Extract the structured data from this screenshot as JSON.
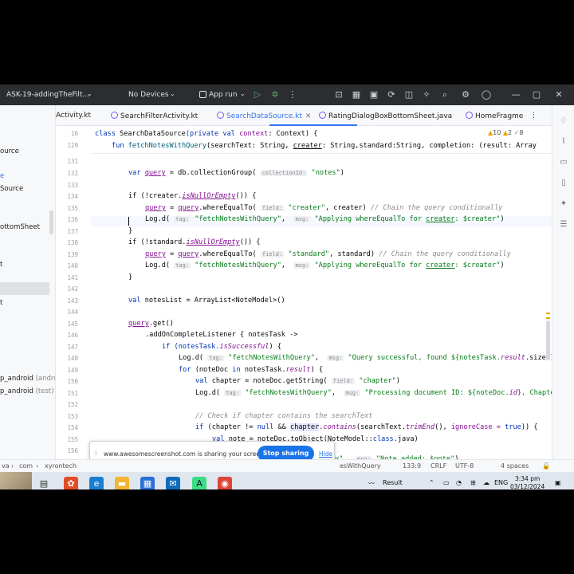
{
  "titlebar": {
    "project": "ASK-19-addingTheFilt...",
    "devices": "No Devices",
    "run_config": "App run"
  },
  "tabs": [
    {
      "label": "Activity.kt"
    },
    {
      "label": "SearchFilterActivity.kt"
    },
    {
      "label": "SearchDataSource.kt"
    },
    {
      "label": "RatingDialogBoxBottomSheet.java"
    },
    {
      "label": "HomeFragme"
    }
  ],
  "inspection": {
    "warnings": "10",
    "weak": "2",
    "ok": "8"
  },
  "project_tree": [
    "ource",
    "e",
    "Source",
    "ottomSheet",
    "t",
    "",
    "t",
    "p_android",
    "p_android"
  ],
  "project_tree_suffix": [
    "(andro",
    "(test)"
  ],
  "gutter": [
    "16",
    "129",
    "131",
    "132",
    "133",
    "134",
    "135",
    "136",
    "137",
    "138",
    "139",
    "140",
    "141",
    "142",
    "143",
    "144",
    "145",
    "146",
    "147",
    "148",
    "149",
    "150",
    "151",
    "152",
    "153",
    "154",
    "155",
    "156"
  ],
  "code": {
    "l16": [
      "class ",
      "SearchDataSource",
      "(private val ",
      "context",
      ": Context) {"
    ],
    "l129": [
      "fun ",
      "fetchNotesWithQuery",
      "(searchText: String, ",
      "creater",
      ": String,standard:String, completion: (result: Array"
    ],
    "l132_a": "var ",
    "l132_b": "query",
    "l132_c": " = db.collectionGroup( ",
    "l132_hint": "collectionId:",
    "l132_str": " \"notes\"",
    "l132_d": ")",
    "l134_a": "if (!creater.",
    "l134_b": "isNullOrEmpty",
    "l134_c": "()) {",
    "l135_a": "query",
    "l135_b": " = ",
    "l135_c": "query",
    "l135_d": ".whereEqualTo( ",
    "l135_hint": "field:",
    "l135_str": " \"creater\"",
    "l135_e": ", creater) ",
    "l135_cm": "// Chain the query conditionally",
    "l136_a": "Log.d( ",
    "l136_hint1": "tag:",
    "l136_str1": " \"fetchNotesWithQuery\"",
    "l136_b": ",  ",
    "l136_hint2": "msg:",
    "l136_str2": " \"Applying whereEqualTo for ",
    "l136_ul": "creater",
    "l136_str3": ": $creater\"",
    "l136_c": ")",
    "l137": "}",
    "l138_a": "if (!standard.",
    "l138_b": "isNullOrEmpty",
    "l138_c": "()) {",
    "l139_a": "query",
    "l139_b": " = ",
    "l139_c": "query",
    "l139_d": ".whereEqualTo( ",
    "l139_hint": "field:",
    "l139_str": " \"standard\"",
    "l139_e": ", standard) ",
    "l139_cm": "// Chain the query conditionally",
    "l140_a": "Log.d( ",
    "l140_hint1": "tag:",
    "l140_str1": " \"fetchNotesWithQuery\"",
    "l140_b": ",  ",
    "l140_hint2": "msg:",
    "l140_str2": " \"Applying whereEqualTo for ",
    "l140_ul": "creater",
    "l140_str3": ": $creater\"",
    "l140_c": ")",
    "l141": "}",
    "l143_a": "val ",
    "l143_b": "notesList = ArrayList<NoteModel>()",
    "l145_a": "query",
    "l145_b": ".get()",
    "l146_a": ".addOnCompleteListener { notesTask ->",
    "l147_a": "if (notesTask.",
    "l147_b": "isSuccessful",
    "l147_c": ") {",
    "l148_a": "Log.d( ",
    "l148_hint1": "tag:",
    "l148_str1": " \"fetchNotesWithQuery\"",
    "l148_b": ",  ",
    "l148_hint2": "msg:",
    "l148_str2": " \"Query successful, found ${notesTask.",
    "l148_it": "result",
    "l148_str3": ".size()",
    "l149_a": "for ",
    "l149_b": "(noteDoc ",
    "l149_c": "in ",
    "l149_d": "notesTask.",
    "l149_it": "result",
    "l149_e": ") {",
    "l150_a": "val ",
    "l150_b": "chapter = noteDoc.getString( ",
    "l150_hint": "field:",
    "l150_str": " \"chapter\"",
    "l150_c": ")",
    "l151_a": "Log.d( ",
    "l151_hint1": "tag:",
    "l151_str1": " \"fetchNotesWithQuery\"",
    "l151_b": ",  ",
    "l151_hint2": "msg:",
    "l151_str2": " \"Processing document ID: ${noteDoc.",
    "l151_it": "id",
    "l151_str3": "}, Chapte",
    "l153_cm": "// Check if chapter contains the searchText",
    "l154_a": "if ",
    "l154_b": "(chapter != ",
    "l154_c": "null ",
    "l154_d": "&& ",
    "l154_e": "chapter",
    "l154_f": ".",
    "l154_g": "contains",
    "l154_h": "(searchText.",
    "l154_i": "trimEnd",
    "l154_j": "(), ",
    "l154_k": "ignoreCase = ",
    "l154_l": "true",
    "l154_m": ")) {",
    "l155_a": "val ",
    "l155_b": "note = noteDoc.toObject(NoteModel::",
    "l155_c": "class",
    "l155_d": ".java)",
    "l156_tail_a": "y\",  ",
    "l156_hint": "msg:",
    "l156_str": " \"Note added: $note\"",
    "l156_c": ")"
  },
  "share_banner": {
    "message": "www.awesomescreenshot.com is sharing your screen.",
    "stop_label": "Stop sharing",
    "hide_label": "Hide"
  },
  "status": {
    "breadcrumb": [
      "va",
      "com",
      "xyrontech"
    ],
    "context": "esWithQuery",
    "position": "133:9",
    "line_sep": "CRLF",
    "encoding": "UTF-8",
    "indent": "4 spaces"
  },
  "taskbar": {
    "weather": "Result",
    "lang": "ENG",
    "time": "3:34 pm",
    "date": "03/12/2024"
  }
}
